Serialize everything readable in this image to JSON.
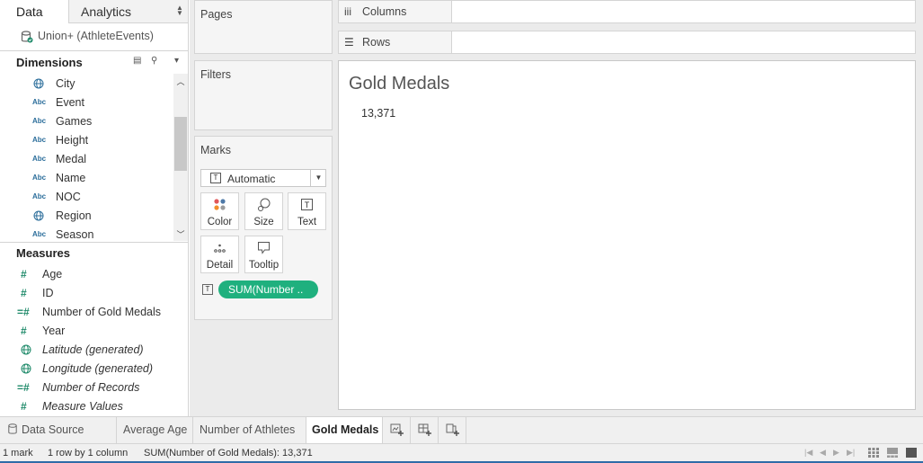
{
  "data_pane": {
    "tabs": [
      "Data",
      "Analytics"
    ],
    "datasource": "Union+ (AthleteEvents)",
    "dimensions_title": "Dimensions",
    "dimensions": [
      {
        "type": "geo",
        "name": "City"
      },
      {
        "type": "Abc",
        "name": "Event"
      },
      {
        "type": "Abc",
        "name": "Games"
      },
      {
        "type": "Abc",
        "name": "Height"
      },
      {
        "type": "Abc",
        "name": "Medal"
      },
      {
        "type": "Abc",
        "name": "Name"
      },
      {
        "type": "Abc",
        "name": "NOC"
      },
      {
        "type": "geo",
        "name": "Region"
      },
      {
        "type": "Abc",
        "name": "Season"
      }
    ],
    "measures_title": "Measures",
    "measures": [
      {
        "name": "Age"
      },
      {
        "name": "ID"
      },
      {
        "name": "Number of Gold Medals"
      },
      {
        "name": "Year"
      },
      {
        "name": "Latitude (generated)"
      },
      {
        "name": "Longitude (generated)"
      },
      {
        "name": "Number of Records"
      },
      {
        "name": "Measure Values"
      }
    ]
  },
  "cards": {
    "pages": "Pages",
    "filters": "Filters",
    "marks": "Marks",
    "mark_type": "Automatic",
    "mark_buttons": [
      "Color",
      "Size",
      "Text",
      "Detail",
      "Tooltip"
    ],
    "pill": "SUM(Number .."
  },
  "shelves": {
    "columns": "Columns",
    "rows": "Rows"
  },
  "view": {
    "title": "Gold Medals",
    "value": "13,371"
  },
  "sheet_tabs": [
    "Data Source",
    "Average Age",
    "Number of Athletes",
    "Gold Medals"
  ],
  "active_tab": "Gold Medals",
  "status": {
    "marks": "1 mark",
    "dims": "1 row by 1 column",
    "sum": "SUM(Number of Gold Medals): 13,371"
  },
  "colors": {
    "pill": "#1fb07e",
    "accent": "#2f6ca8"
  }
}
